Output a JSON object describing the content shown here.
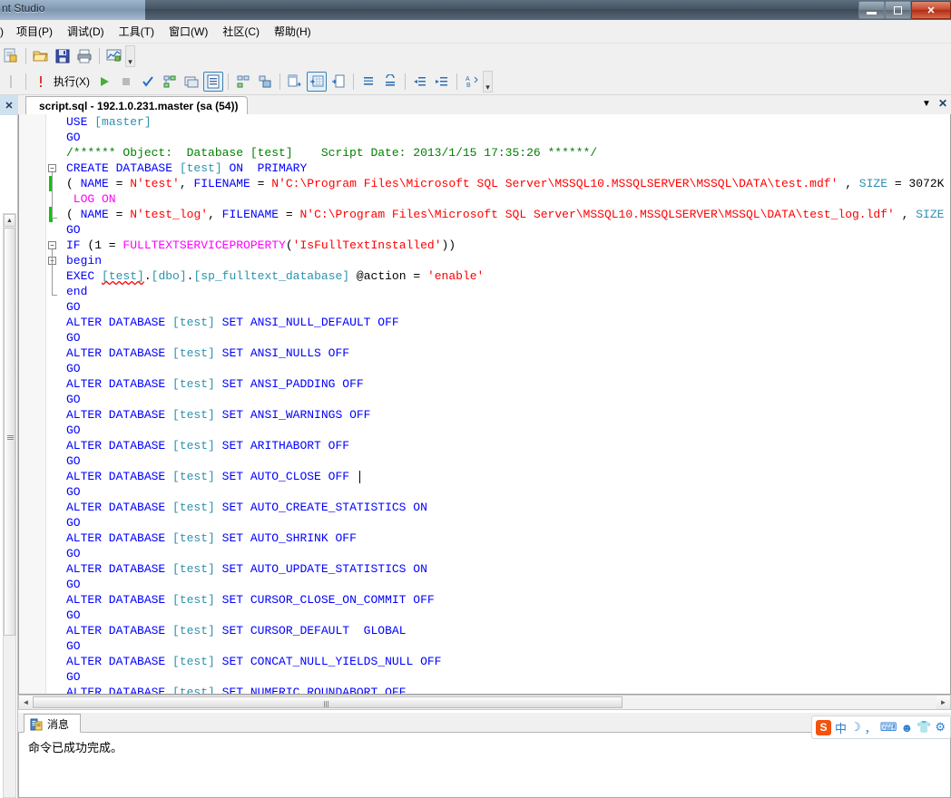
{
  "window": {
    "title": "nt Studio",
    "minimize_label": "Minimize",
    "restore_label": "Restore",
    "close_label": "✕"
  },
  "menubar": {
    "items": [
      {
        "label": ")",
        "name": "menu-partial"
      },
      {
        "label": "项目(P)",
        "name": "menu-project"
      },
      {
        "label": "调试(D)",
        "name": "menu-debug"
      },
      {
        "label": "工具(T)",
        "name": "menu-tools"
      },
      {
        "label": "窗口(W)",
        "name": "menu-window"
      },
      {
        "label": "社区(C)",
        "name": "menu-community"
      },
      {
        "label": "帮助(H)",
        "name": "menu-help"
      }
    ]
  },
  "toolbar_standard": {
    "overflow_label": "▾",
    "buttons": [
      {
        "name": "new-query-icon",
        "title": "新建查询"
      },
      {
        "name": "open-file-icon",
        "title": "打开文件"
      },
      {
        "name": "save-icon",
        "title": "保存"
      },
      {
        "name": "print-icon",
        "title": "打印"
      },
      {
        "name": "activity-monitor-icon",
        "title": "活动监视器"
      }
    ]
  },
  "toolbar_sqleditor": {
    "execute_label": "执行(X)",
    "overflow_label": "▾",
    "buttons": [
      {
        "name": "debug-icon",
        "title": "调试"
      },
      {
        "name": "run-icon",
        "title": "运行"
      },
      {
        "name": "stop-icon",
        "title": "停止"
      },
      {
        "name": "parse-check-icon",
        "title": "分析"
      },
      {
        "name": "display-estimated-plan-icon",
        "title": "显示估计的执行计划"
      },
      {
        "name": "query-options-icon",
        "title": "查询选项"
      },
      {
        "name": "include-actual-plan-icon",
        "title": "包括实际的执行计划"
      },
      {
        "name": "include-client-statistics-icon",
        "title": "包括客户端统计信息"
      },
      {
        "name": "results-to-grid-icon",
        "title": "以网格显示结果"
      },
      {
        "name": "results-to-text-icon",
        "title": "以文本显示结果"
      },
      {
        "name": "results-to-file-icon",
        "title": "将结果保存到文件"
      },
      {
        "name": "comment-icon",
        "title": "注释选定行"
      },
      {
        "name": "uncomment-icon",
        "title": "取消对选定行的注释"
      },
      {
        "name": "decrease-indent-icon",
        "title": "减少缩进"
      },
      {
        "name": "increase-indent-icon",
        "title": "增加缩进"
      },
      {
        "name": "sort-az-icon",
        "title": "排序"
      }
    ]
  },
  "editor": {
    "tab_title": "script.sql - 192.1.0.231.master (sa (54))",
    "tab_dropdown_label": "▼",
    "tab_close_label": "✕",
    "lines": [
      {
        "indent": 0,
        "tokens": [
          {
            "t": "USE ",
            "c": "k"
          },
          {
            "t": "[master]",
            "c": "b"
          }
        ]
      },
      {
        "indent": 0,
        "tokens": [
          {
            "t": "GO",
            "c": "k"
          }
        ]
      },
      {
        "indent": 0,
        "tokens": [
          {
            "t": "/****** Object:  Database [test]    Script Date: 2013/1/15 17:35:26 ******/",
            "c": "c"
          }
        ]
      },
      {
        "indent": 0,
        "fold": "start",
        "tokens": [
          {
            "t": "CREATE DATABASE ",
            "c": "k"
          },
          {
            "t": "[test]",
            "c": "b"
          },
          {
            "t": " ON  ",
            "c": "k"
          },
          {
            "t": "PRIMARY",
            "c": "k"
          }
        ]
      },
      {
        "indent": 0,
        "change": true,
        "tokens": [
          {
            "t": "( ",
            "c": "n"
          },
          {
            "t": "NAME",
            "c": "k"
          },
          {
            "t": " = ",
            "c": "n"
          },
          {
            "t": "N'test'",
            "c": "s"
          },
          {
            "t": ", ",
            "c": "n"
          },
          {
            "t": "FILENAME",
            "c": "k"
          },
          {
            "t": " = ",
            "c": "n"
          },
          {
            "t": "N'C:\\Program Files\\Microsoft SQL Server\\MSSQL10.MSSQLSERVER\\MSSQL\\DATA\\test.mdf'",
            "c": "s"
          },
          {
            "t": " , ",
            "c": "n"
          },
          {
            "t": "SIZE",
            "c": "b"
          },
          {
            "t": " = 3072K",
            "c": "n"
          }
        ]
      },
      {
        "indent": 0,
        "tokens": [
          {
            "t": " LOG ON",
            "c": "f"
          }
        ]
      },
      {
        "indent": 0,
        "change": true,
        "fold": "end",
        "tokens": [
          {
            "t": "( ",
            "c": "n"
          },
          {
            "t": "NAME",
            "c": "k"
          },
          {
            "t": " = ",
            "c": "n"
          },
          {
            "t": "N'test_log'",
            "c": "s"
          },
          {
            "t": ", ",
            "c": "n"
          },
          {
            "t": "FILENAME",
            "c": "k"
          },
          {
            "t": " = ",
            "c": "n"
          },
          {
            "t": "N'C:\\Program Files\\Microsoft SQL Server\\MSSQL10.MSSQLSERVER\\MSSQL\\DATA\\test_log.ldf'",
            "c": "s"
          },
          {
            "t": " , ",
            "c": "n"
          },
          {
            "t": "SIZE",
            "c": "b"
          }
        ]
      },
      {
        "indent": 0,
        "tokens": [
          {
            "t": "GO",
            "c": "k"
          }
        ]
      },
      {
        "indent": 0,
        "fold": "start",
        "tokens": [
          {
            "t": "IF ",
            "c": "k"
          },
          {
            "t": "(1 = ",
            "c": "n"
          },
          {
            "t": "FULLTEXTSERVICEPROPERTY",
            "c": "f"
          },
          {
            "t": "(",
            "c": "n"
          },
          {
            "t": "'IsFullTextInstalled'",
            "c": "s"
          },
          {
            "t": "))",
            "c": "n"
          }
        ]
      },
      {
        "indent": 0,
        "fold": "start2",
        "tokens": [
          {
            "t": "begin",
            "c": "k"
          }
        ]
      },
      {
        "indent": 0,
        "tokens": [
          {
            "t": "EXEC ",
            "c": "k"
          },
          {
            "t": "[test]",
            "c": "b squiggle"
          },
          {
            "t": ".",
            "c": "n"
          },
          {
            "t": "[dbo]",
            "c": "b"
          },
          {
            "t": ".",
            "c": "n"
          },
          {
            "t": "[sp_fulltext_database]",
            "c": "b"
          },
          {
            "t": " @action",
            "c": "n"
          },
          {
            "t": " = ",
            "c": "n"
          },
          {
            "t": "'enable'",
            "c": "s"
          }
        ]
      },
      {
        "indent": 0,
        "fold": "end2",
        "tokens": [
          {
            "t": "end",
            "c": "k"
          }
        ]
      },
      {
        "indent": 0,
        "tokens": [
          {
            "t": "GO",
            "c": "k"
          }
        ]
      },
      {
        "indent": 0,
        "tokens": [
          {
            "t": "ALTER DATABASE ",
            "c": "k"
          },
          {
            "t": "[test]",
            "c": "b"
          },
          {
            "t": " SET ANSI_NULL_DEFAULT OFF",
            "c": "k"
          }
        ]
      },
      {
        "indent": 0,
        "tokens": [
          {
            "t": "GO",
            "c": "k"
          }
        ]
      },
      {
        "indent": 0,
        "tokens": [
          {
            "t": "ALTER DATABASE ",
            "c": "k"
          },
          {
            "t": "[test]",
            "c": "b"
          },
          {
            "t": " SET ANSI_NULLS OFF",
            "c": "k"
          }
        ]
      },
      {
        "indent": 0,
        "tokens": [
          {
            "t": "GO",
            "c": "k"
          }
        ]
      },
      {
        "indent": 0,
        "tokens": [
          {
            "t": "ALTER DATABASE ",
            "c": "k"
          },
          {
            "t": "[test]",
            "c": "b"
          },
          {
            "t": " SET ANSI_PADDING OFF",
            "c": "k"
          }
        ]
      },
      {
        "indent": 0,
        "tokens": [
          {
            "t": "GO",
            "c": "k"
          }
        ]
      },
      {
        "indent": 0,
        "tokens": [
          {
            "t": "ALTER DATABASE ",
            "c": "k"
          },
          {
            "t": "[test]",
            "c": "b"
          },
          {
            "t": " SET ANSI_WARNINGS OFF",
            "c": "k"
          }
        ]
      },
      {
        "indent": 0,
        "tokens": [
          {
            "t": "GO",
            "c": "k"
          }
        ]
      },
      {
        "indent": 0,
        "tokens": [
          {
            "t": "ALTER DATABASE ",
            "c": "k"
          },
          {
            "t": "[test]",
            "c": "b"
          },
          {
            "t": " SET ARITHABORT OFF",
            "c": "k"
          }
        ]
      },
      {
        "indent": 0,
        "tokens": [
          {
            "t": "GO",
            "c": "k"
          }
        ]
      },
      {
        "indent": 0,
        "caret": true,
        "tokens": [
          {
            "t": "ALTER DATABASE ",
            "c": "k"
          },
          {
            "t": "[test]",
            "c": "b"
          },
          {
            "t": " SET AUTO_CLOSE OFF ",
            "c": "k"
          }
        ]
      },
      {
        "indent": 0,
        "tokens": [
          {
            "t": "GO",
            "c": "k"
          }
        ]
      },
      {
        "indent": 0,
        "tokens": [
          {
            "t": "ALTER DATABASE ",
            "c": "k"
          },
          {
            "t": "[test]",
            "c": "b"
          },
          {
            "t": " SET AUTO_CREATE_STATISTICS ON",
            "c": "k"
          }
        ]
      },
      {
        "indent": 0,
        "tokens": [
          {
            "t": "GO",
            "c": "k"
          }
        ]
      },
      {
        "indent": 0,
        "tokens": [
          {
            "t": "ALTER DATABASE ",
            "c": "k"
          },
          {
            "t": "[test]",
            "c": "b"
          },
          {
            "t": " SET AUTO_SHRINK OFF",
            "c": "k"
          }
        ]
      },
      {
        "indent": 0,
        "tokens": [
          {
            "t": "GO",
            "c": "k"
          }
        ]
      },
      {
        "indent": 0,
        "tokens": [
          {
            "t": "ALTER DATABASE ",
            "c": "k"
          },
          {
            "t": "[test]",
            "c": "b"
          },
          {
            "t": " SET AUTO_UPDATE_STATISTICS ON",
            "c": "k"
          }
        ]
      },
      {
        "indent": 0,
        "tokens": [
          {
            "t": "GO",
            "c": "k"
          }
        ]
      },
      {
        "indent": 0,
        "tokens": [
          {
            "t": "ALTER DATABASE ",
            "c": "k"
          },
          {
            "t": "[test]",
            "c": "b"
          },
          {
            "t": " SET CURSOR_CLOSE_ON_COMMIT OFF",
            "c": "k"
          }
        ]
      },
      {
        "indent": 0,
        "tokens": [
          {
            "t": "GO",
            "c": "k"
          }
        ]
      },
      {
        "indent": 0,
        "tokens": [
          {
            "t": "ALTER DATABASE ",
            "c": "k"
          },
          {
            "t": "[test]",
            "c": "b"
          },
          {
            "t": " SET CURSOR_DEFAULT  GLOBAL",
            "c": "k"
          }
        ]
      },
      {
        "indent": 0,
        "tokens": [
          {
            "t": "GO",
            "c": "k"
          }
        ]
      },
      {
        "indent": 0,
        "tokens": [
          {
            "t": "ALTER DATABASE ",
            "c": "k"
          },
          {
            "t": "[test]",
            "c": "b"
          },
          {
            "t": " SET CONCAT_NULL_YIELDS_NULL OFF",
            "c": "k"
          }
        ]
      },
      {
        "indent": 0,
        "tokens": [
          {
            "t": "GO",
            "c": "k"
          }
        ]
      },
      {
        "indent": 0,
        "tokens": [
          {
            "t": "ALTER DATABASE ",
            "c": "k"
          },
          {
            "t": "[test]",
            "c": "b"
          },
          {
            "t": " SET NUMERIC_ROUNDABORT OFF",
            "c": "k"
          }
        ]
      }
    ]
  },
  "messages": {
    "tab_label": "消息",
    "tab_icon": "messages-icon",
    "text": "命令已成功完成。"
  },
  "ime": {
    "logo_label": "S",
    "items": [
      {
        "name": "chinese-mode-icon",
        "label": "中"
      },
      {
        "name": "moon-icon",
        "label": "☽"
      },
      {
        "name": "punctuation-icon",
        "label": "，"
      },
      {
        "name": "soft-keyboard-icon",
        "label": "⌨"
      },
      {
        "name": "user-icon",
        "label": "☻"
      },
      {
        "name": "skin-icon",
        "label": "👕"
      },
      {
        "name": "tools-icon",
        "label": "⚙"
      }
    ]
  },
  "colors": {
    "keyword": "#0000ff",
    "string": "#ff0000",
    "comment": "#008000",
    "identifier": "#2b91af",
    "function": "#ff00ff",
    "changebar": "#0ec50e",
    "accent": "#3c7fb1"
  }
}
